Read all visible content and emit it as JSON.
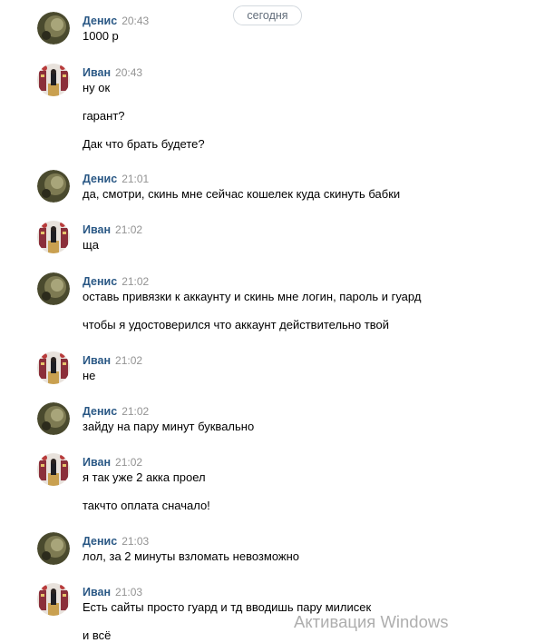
{
  "date_divider": "сегодня",
  "messages": [
    {
      "author": "Денис",
      "time": "20:43",
      "avatar": "avatar-denis",
      "lines": [
        "1000 р"
      ]
    },
    {
      "author": "Иван",
      "time": "20:43",
      "avatar": "avatar-ivan",
      "lines": [
        "ну ок",
        "гарант?",
        "Дак что брать будете?"
      ]
    },
    {
      "author": "Денис",
      "time": "21:01",
      "avatar": "avatar-denis",
      "lines": [
        "да, смотри, скинь мне сейчас кошелек куда скинуть бабки"
      ]
    },
    {
      "author": "Иван",
      "time": "21:02",
      "avatar": "avatar-ivan",
      "lines": [
        "ща"
      ]
    },
    {
      "author": "Денис",
      "time": "21:02",
      "avatar": "avatar-denis",
      "lines": [
        "оставь привязки к аккаунту и скинь мне логин, пароль и гуард",
        "чтобы я удостоверился что аккаунт действительно твой"
      ]
    },
    {
      "author": "Иван",
      "time": "21:02",
      "avatar": "avatar-ivan",
      "lines": [
        "не"
      ]
    },
    {
      "author": "Денис",
      "time": "21:02",
      "avatar": "avatar-denis",
      "lines": [
        "зайду на пару минут буквально"
      ]
    },
    {
      "author": "Иван",
      "time": "21:02",
      "avatar": "avatar-ivan",
      "lines": [
        "я так уже 2 акка проел",
        "такчто оплата сначало!"
      ]
    },
    {
      "author": "Денис",
      "time": "21:03",
      "avatar": "avatar-denis",
      "lines": [
        "лол, за 2 минуты взломать невозможно"
      ]
    },
    {
      "author": "Иван",
      "time": "21:03",
      "avatar": "avatar-ivan",
      "lines": [
        "Есть сайты просто гуард и тд вводишь пару милисек",
        "и всё"
      ]
    }
  ],
  "watermark": "Активация Windows"
}
